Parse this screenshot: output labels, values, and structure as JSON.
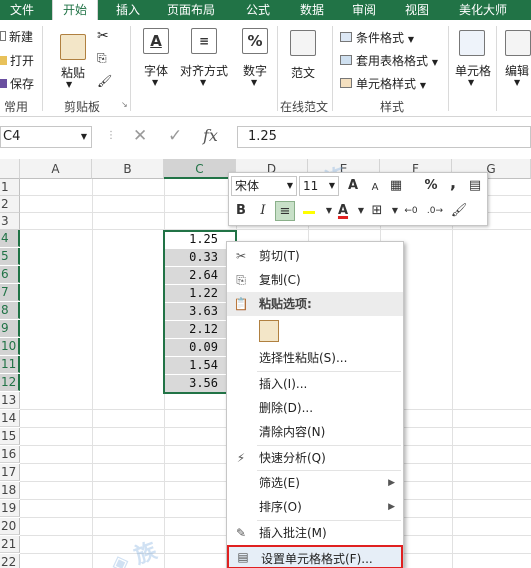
{
  "tabs": [
    "文件",
    "开始",
    "插入",
    "页面布局",
    "公式",
    "数据",
    "审阅",
    "视图",
    "美化大师"
  ],
  "ribbon": {
    "new": "新建",
    "open": "打开",
    "save": "保存",
    "group_common": "常用",
    "paste": "粘贴",
    "group_clipboard": "剪贴板",
    "font": "字体",
    "alignment": "对齐方式",
    "number": "数字",
    "fanwen": "范文",
    "group_online": "在线范文",
    "cond_format": "条件格式",
    "table_format": "套用表格格式",
    "cell_style": "单元格样式",
    "group_styles": "样式",
    "cells": "单元格",
    "edit": "编辑"
  },
  "formula_bar": {
    "name_box": "C4",
    "content": "1.25"
  },
  "columns": [
    "A",
    "B",
    "C",
    "D",
    "E",
    "F",
    "G"
  ],
  "rows": [
    "1",
    "2",
    "3",
    "4",
    "5",
    "6",
    "7",
    "8",
    "9",
    "10",
    "11",
    "12",
    "13",
    "14",
    "15",
    "16",
    "17",
    "18",
    "19",
    "20",
    "21",
    "22"
  ],
  "cells_c": [
    "1.25",
    "0.33",
    "2.64",
    "1.22",
    "3.63",
    "2.12",
    "0.09",
    "1.54",
    "3.56"
  ],
  "mini_toolbar": {
    "font_name": "宋体",
    "font_size": "11",
    "bold": "B",
    "italic": "I",
    "percent": "%",
    "comma": ",",
    "font_color": "A"
  },
  "context_menu": {
    "cut": "剪切(T)",
    "copy": "复制(C)",
    "paste_options": "粘贴选项:",
    "paste_special": "选择性粘贴(S)...",
    "insert": "插入(I)...",
    "delete": "删除(D)...",
    "clear": "清除内容(N)",
    "quick_analysis": "快速分析(Q)",
    "filter": "筛选(E)",
    "sort": "排序(O)",
    "insert_comment": "插入批注(M)",
    "format_cells": "设置单元格格式(F)..."
  },
  "colors": {
    "excel_green": "#217346",
    "highlight_border": "#e02020"
  }
}
